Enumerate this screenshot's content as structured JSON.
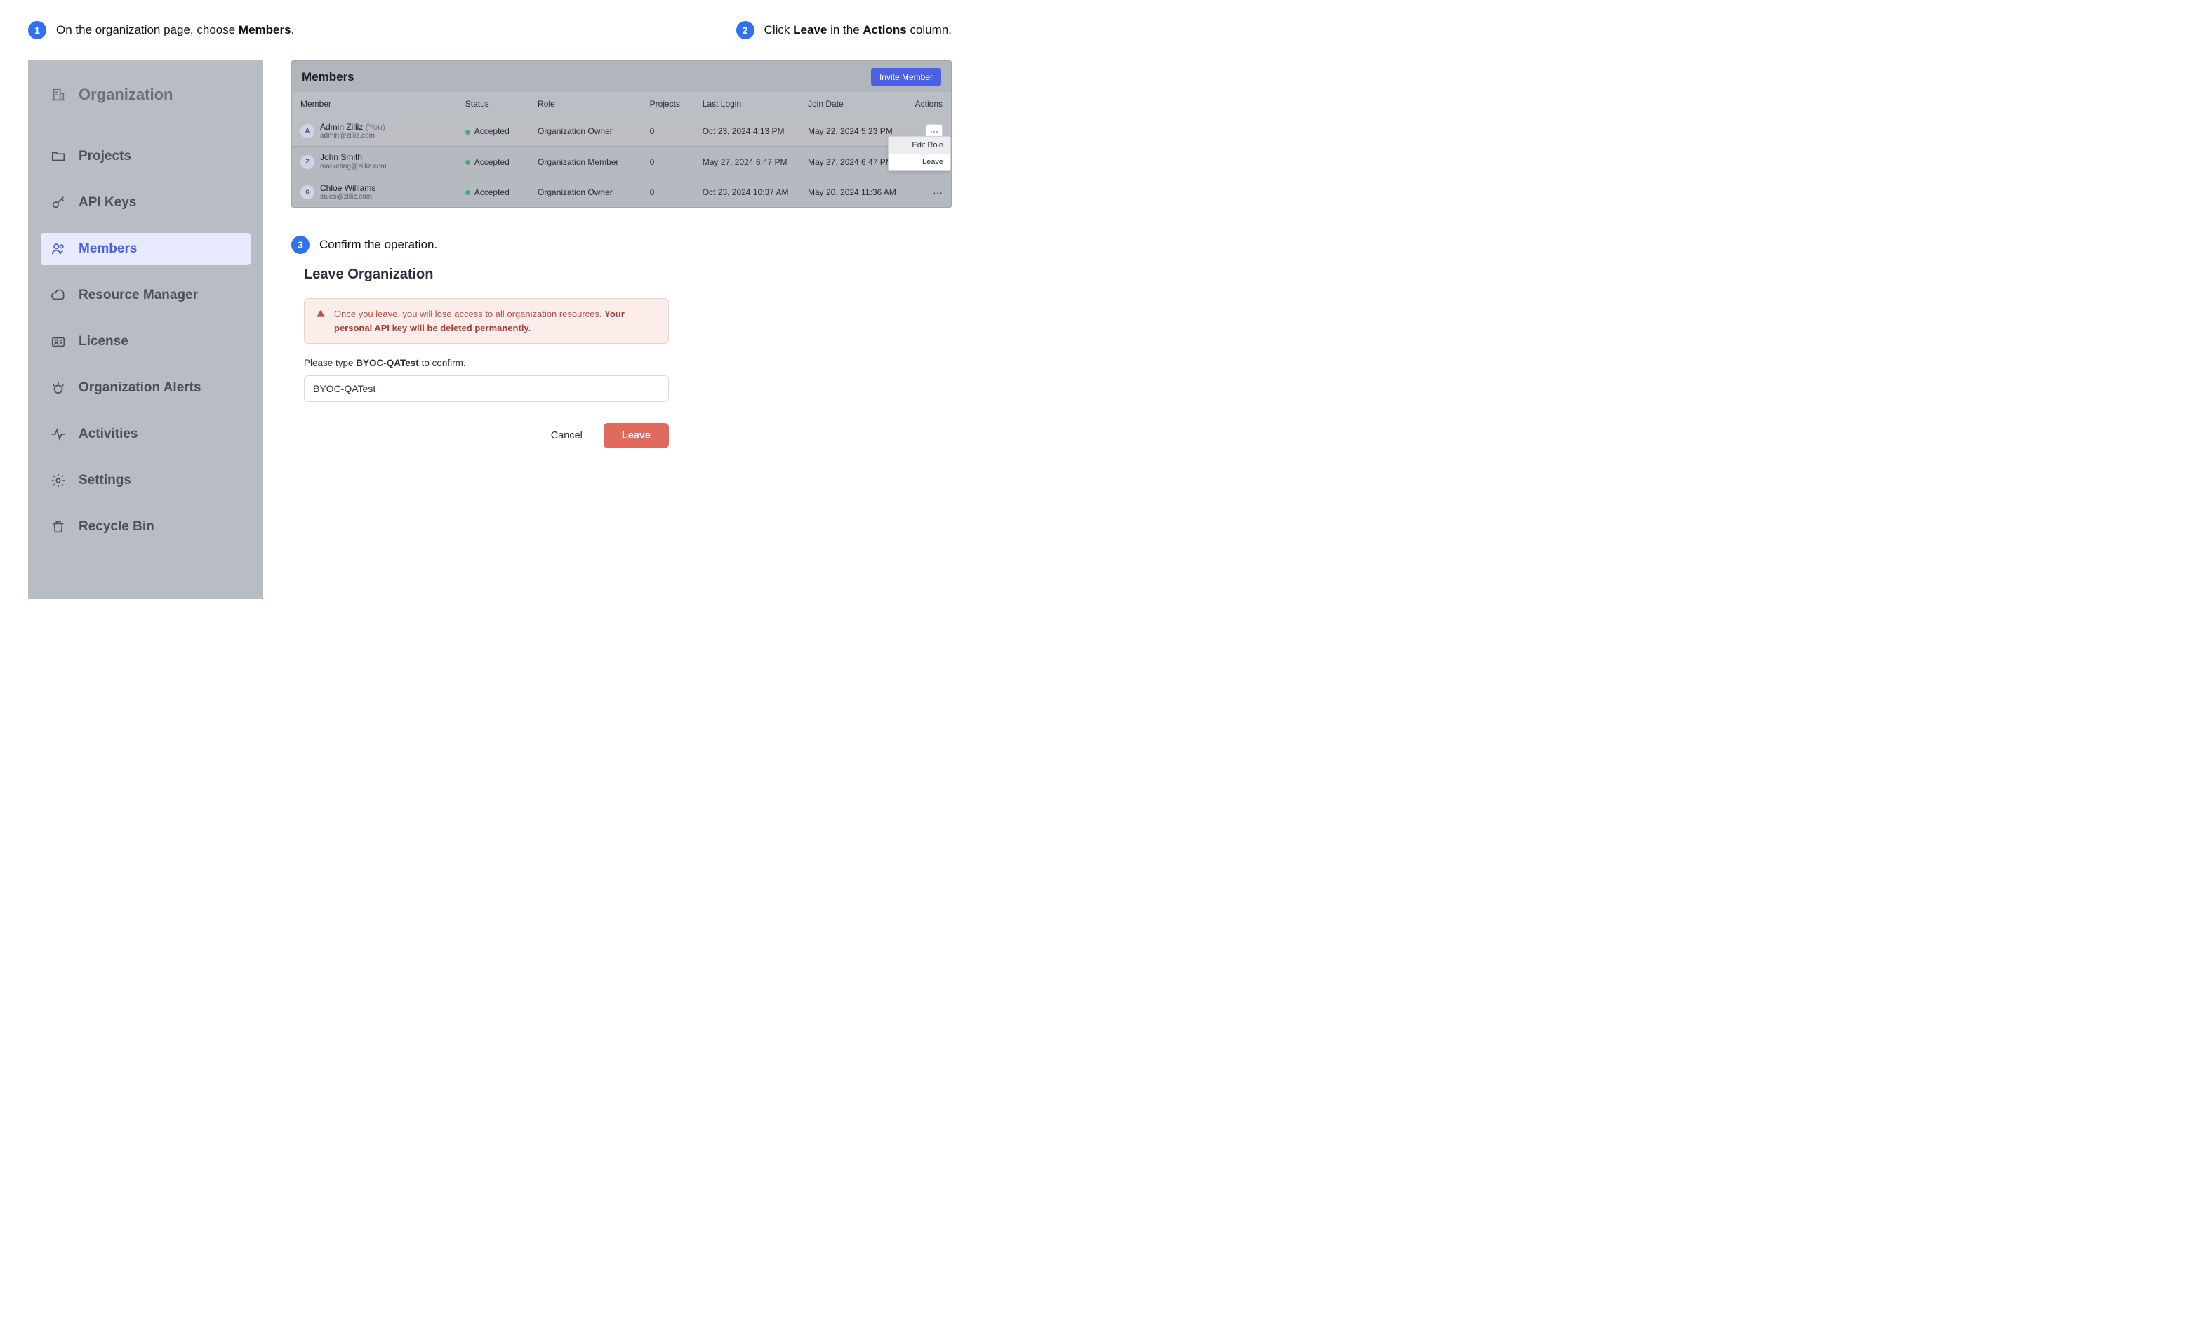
{
  "steps": {
    "s1": {
      "num": "1",
      "pre": "On the organization page, choose ",
      "bold": "Members",
      "post": "."
    },
    "s2": {
      "num": "2",
      "pre": "Click ",
      "bold1": "Leave",
      "mid": " in the ",
      "bold2": "Actions",
      "post": " column."
    },
    "s3": {
      "num": "3",
      "text": "Confirm the operation."
    }
  },
  "sidebar": {
    "heading": "Organization",
    "items": [
      {
        "label": "Projects"
      },
      {
        "label": "API Keys"
      },
      {
        "label": "Members"
      },
      {
        "label": "Resource Manager"
      },
      {
        "label": "License"
      },
      {
        "label": "Organization Alerts"
      },
      {
        "label": "Activities"
      },
      {
        "label": "Settings"
      },
      {
        "label": "Recycle Bin"
      }
    ]
  },
  "members_panel": {
    "title": "Members",
    "invite_label": "Invite Member",
    "columns": {
      "member": "Member",
      "status": "Status",
      "role": "Role",
      "projects": "Projects",
      "last_login": "Last Login",
      "join_date": "Join Date",
      "actions": "Actions"
    },
    "rows": [
      {
        "avatar": "A",
        "name": "Admin Zilliz",
        "you": "(You)",
        "email": "admin@zilliz.com",
        "status": "Accepted",
        "role": "Organization Owner",
        "projects": "0",
        "last_login": "Oct 23, 2024 4:13 PM",
        "join_date": "May 22, 2024 5:23 PM"
      },
      {
        "avatar": "2",
        "name": "John Smith",
        "you": "",
        "email": "marketing@zilliz.com",
        "status": "Accepted",
        "role": "Organization Member",
        "projects": "0",
        "last_login": "May 27, 2024 6:47 PM",
        "join_date": "May 27, 2024 6:47 PM"
      },
      {
        "avatar": "c",
        "name": "Chloe Williams",
        "you": "",
        "email": "sales@zilliz.com",
        "status": "Accepted",
        "role": "Organization Owner",
        "projects": "0",
        "last_login": "Oct 23, 2024 10:37 AM",
        "join_date": "May 20, 2024 11:36 AM"
      }
    ],
    "dropdown": {
      "edit_role": "Edit Role",
      "leave": "Leave"
    }
  },
  "modal": {
    "title": "Leave Organization",
    "warning_plain": "Once you leave, you will lose access to all organization resources. ",
    "warning_bold": "Your personal API key will be deleted permanently.",
    "confirm_pre": "Please type ",
    "confirm_bold": "BYOC-QATest",
    "confirm_post": " to confirm.",
    "input_value": "BYOC-QATest",
    "cancel": "Cancel",
    "leave": "Leave"
  }
}
